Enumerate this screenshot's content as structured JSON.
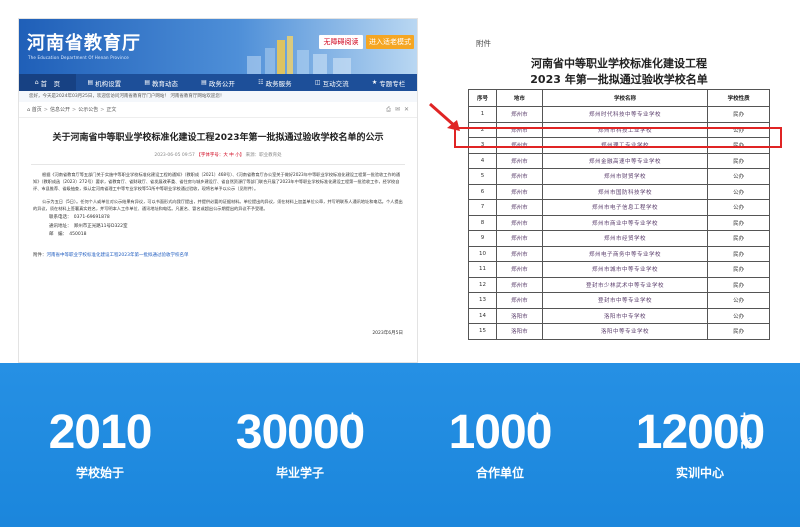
{
  "site": {
    "logo": "河南省教育厅",
    "logo_sub": "The Education Department Of Henan Province",
    "btn_accessible": "无障碍阅读",
    "btn_elder": "进入适老模式",
    "nav": [
      {
        "icon": "home-icon",
        "glyph": "⌂",
        "label": "首　页"
      },
      {
        "icon": "doc-icon",
        "glyph": "▤",
        "label": "机构设置"
      },
      {
        "icon": "doc-icon",
        "glyph": "▤",
        "label": "教育动态"
      },
      {
        "icon": "doc-icon",
        "glyph": "▤",
        "label": "政务公开"
      },
      {
        "icon": "people-icon",
        "glyph": "☷",
        "label": "政务服务"
      },
      {
        "icon": "chat-icon",
        "glyph": "◫",
        "label": "互动交流"
      },
      {
        "icon": "star-icon",
        "glyph": "★",
        "label": "专题专栏"
      }
    ],
    "notice": "您好，今天是2024年03月25日，欢迎您访问河南省教育厅门户网站！ 河南省教育厅网站欢迎您！",
    "breadcrumb": [
      "首页",
      "信息公开",
      "公示公告",
      "正文"
    ],
    "article": {
      "title": "关于河南省中等职业学校标准化建设工程2023年第一批拟通过验收学校名单的公示",
      "meta_date": "2023-06-05 09:57",
      "meta_size": "【字体字号：大 中 小】",
      "meta_source": "来源：职业教育处",
      "para1": "根据《河南省教育厅等五部门关于实施中等职业学校标准化建设工程的通知》（教职成〔2021〕468号）、《河南省教育厅办公室关于做好2023年中等职业学校标准化建设工程第一批验收工作的通知》（教职成函〔2023〕272号）要求，省教育厅、省财政厅、省发展改革委、省住房与城乡建设厅、省自然资源厅等部门联合开展了2023年中等职业学校标准化建设工程第一批验收工作，经学校自评、市县推荐、省级抽查，拟认定河南省理工中等专业学校等51所中等职业学校通过验收，现将名单予以公示（见附件）。",
      "para2": "公示为五日（5日）。任何个人或单位对公示结果有异议，可以书面形式向我厅提出，并提供必要的证据材料。单位提出的异议，须在材料上加盖单位公章，并写明联系人通讯地址和电话。个人提出的异议，须在材料上签署真实姓名，并写明本人工作单位、通讯地址和电话。凡匿名、冒名或超出公示期提出的异议不予受理。",
      "contact_phone": "联系电话：　0371-69691878",
      "contact_addr": "通讯地址：　郑州市正光路11号D322室",
      "contact_zip": "邮　编：　450018",
      "attach_label": "附件：",
      "attach_link": "河南省中等职业学校标准化建设工程2023年第一批拟通过验收学校名单",
      "sign_date": "2023年6月5日"
    }
  },
  "doc": {
    "label": "附件",
    "title_line1": "河南省中等职业学校标准化建设工程",
    "title_line2": "2023 年第一批拟通过验收学校名单",
    "headers": [
      "序号",
      "地市",
      "学校名称",
      "学校性质"
    ],
    "rows": [
      [
        "1",
        "郑州市",
        "郑州时代科技中等专业学校",
        "民办"
      ],
      [
        "2",
        "郑州市",
        "郑州市科技工业学校",
        "公办"
      ],
      [
        "3",
        "郑州市",
        "郑州理工专业学校",
        "民办"
      ],
      [
        "4",
        "郑州市",
        "郑州金融高速中等专业学校",
        "民办"
      ],
      [
        "5",
        "郑州市",
        "郑州市财贸学校",
        "公办"
      ],
      [
        "6",
        "郑州市",
        "郑州市国防科技学校",
        "公办"
      ],
      [
        "7",
        "郑州市",
        "郑州市电子信息工程学校",
        "公办"
      ],
      [
        "8",
        "郑州市",
        "郑州市商业中等专业学校",
        "民办"
      ],
      [
        "9",
        "郑州市",
        "郑州市经贸学校",
        "民办"
      ],
      [
        "10",
        "郑州市",
        "郑州电子商务中等专业学校",
        "民办"
      ],
      [
        "11",
        "郑州市",
        "郑州市城市中等专业学校",
        "民办"
      ],
      [
        "12",
        "郑州市",
        "登封市少林武术中等专业学校",
        "民办"
      ],
      [
        "13",
        "郑州市",
        "登封市中等专业学校",
        "公办"
      ],
      [
        "14",
        "洛阳市",
        "洛阳市中专学校",
        "公办"
      ],
      [
        "15",
        "洛阳市",
        "洛阳中等专业学校",
        "民办"
      ]
    ]
  },
  "stats": [
    {
      "number": "2010",
      "sup": "",
      "unit": "",
      "label": "学校始于"
    },
    {
      "number": "30000",
      "sup": "+",
      "unit": "",
      "label": "毕业学子"
    },
    {
      "number": "1000",
      "sup": "+",
      "unit": "",
      "label": "合作单位"
    },
    {
      "number": "12000",
      "sup": "+",
      "unit": "㎡",
      "label": "实训中心"
    }
  ],
  "colors": {
    "header_blue": "#1f5fb8",
    "nav_blue": "#1d4f99",
    "stats_blue": "#1b86dc",
    "highlight_red": "#e02424",
    "btn_orange": "#f5a623"
  }
}
